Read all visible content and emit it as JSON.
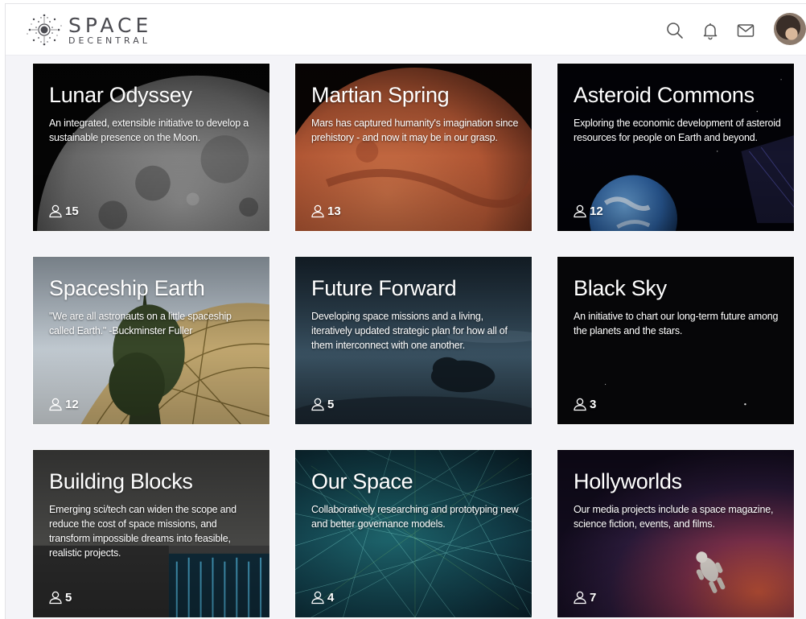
{
  "header": {
    "logo_main": "SPACE",
    "logo_sub": "DECENTRAL",
    "icons": [
      "search-icon",
      "bell-icon",
      "mail-icon"
    ]
  },
  "colors": {
    "page_bg": "#f4f4f8",
    "header_bg": "#ffffff",
    "text_on_card": "#ffffff",
    "logo_text": "#4a4a50"
  },
  "cards": [
    {
      "title": "Lunar Odyssey",
      "description": "An integrated, extensible initiative to develop a sustainable presence on the Moon.",
      "members": "15",
      "theme": "moon"
    },
    {
      "title": "Martian Spring",
      "description": "Mars has captured humanity's imagination since prehistory - and now it may be in our grasp.",
      "members": "13",
      "theme": "mars"
    },
    {
      "title": "Asteroid Commons",
      "description": "Exploring the economic development of asteroid resources for people on Earth and beyond.",
      "members": "12",
      "theme": "earth"
    },
    {
      "title": "Spaceship Earth",
      "description": "\"We are all astronauts on a little spaceship called Earth.\" -Buckminster Fuller",
      "members": "12",
      "theme": "dome"
    },
    {
      "title": "Future Forward",
      "description": "Developing space missions and a living, iteratively updated strategic plan for how all of them interconnect with one another.",
      "members": "5",
      "theme": "clouds"
    },
    {
      "title": "Black Sky",
      "description": "An initiative to chart our long-term future among the planets and the stars.",
      "members": "3",
      "theme": "blacksky"
    },
    {
      "title": "Building Blocks",
      "description": "Emerging sci/tech can widen the scope and reduce the cost of space missions, and transform impossible dreams into feasible, realistic projects.",
      "members": "5",
      "theme": "concrete"
    },
    {
      "title": "Our Space",
      "description": "Collaboratively researching and prototyping new and better governance models.",
      "members": "4",
      "theme": "network"
    },
    {
      "title": "Hollyworlds",
      "description": "Our media projects include a space magazine, science fiction, events, and films.",
      "members": "7",
      "theme": "nebula"
    }
  ]
}
